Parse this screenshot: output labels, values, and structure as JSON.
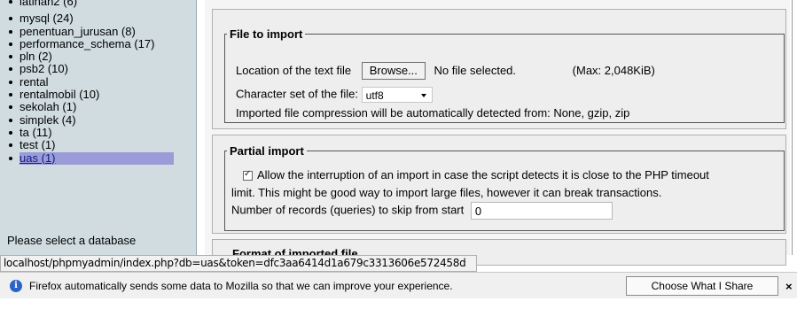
{
  "sidebar": {
    "databases": [
      {
        "label": "latihan2 (6)"
      },
      {
        "label": "mysql (24)"
      },
      {
        "label": "penentuan_jurusan (8)"
      },
      {
        "label": "performance_schema (17)"
      },
      {
        "label": "pln (2)"
      },
      {
        "label": "psb2 (10)"
      },
      {
        "label": "rental"
      },
      {
        "label": "rentalmobil (10)"
      },
      {
        "label": "sekolah (1)"
      },
      {
        "label": "simplek (4)"
      },
      {
        "label": "ta (11)"
      },
      {
        "label": "test (1)"
      },
      {
        "label": "uas (1)",
        "selected": true
      }
    ],
    "hint": "Please select a database"
  },
  "file_import": {
    "legend": "File to import",
    "location_label": "Location of the text file",
    "browse_label": "Browse...",
    "no_file_label": "No file selected.",
    "max_size": "(Max: 2,048KiB)",
    "charset_label": "Character set of the file:",
    "charset_value": "utf8",
    "compression_note": "Imported file compression will be automatically detected from: None, gzip, zip"
  },
  "partial_import": {
    "legend": "Partial import",
    "allow_interrupt_line1": "Allow the interruption of an import in case the script detects it is close to the PHP timeout",
    "allow_interrupt_line2": "limit. This might be good way to import large files, however it can break transactions.",
    "allow_interrupt_checked": true,
    "skip_label": "Number of records (queries) to skip from start",
    "skip_value": "0"
  },
  "format_section": {
    "legend": "Format of imported file"
  },
  "status_bar": {
    "url": "localhost/phpmyadmin/index.php?db=uas&token=dfc3aa6414d1a679c3313606e572458d"
  },
  "notification": {
    "icon": "info-icon",
    "text": "Firefox automatically sends some data to Mozilla so that we can improve your experience.",
    "button_label": "Choose What I Share",
    "close_label": "×"
  },
  "colors": {
    "sidebar_bg": "#d0dce0",
    "selected_bg": "#9b9bd8",
    "panel_bg": "#eeeeee",
    "info_blue": "#2b64c5"
  }
}
